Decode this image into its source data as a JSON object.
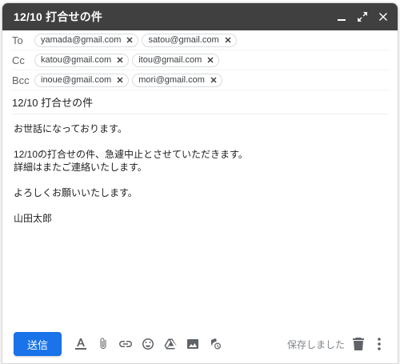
{
  "window": {
    "title": "12/10 打合せの件"
  },
  "to": {
    "label": "To",
    "chips": [
      "yamada@gmail.com",
      "satou@gmail.com"
    ]
  },
  "cc": {
    "label": "Cc",
    "chips": [
      "katou@gmail.com",
      "itou@gmail.com"
    ]
  },
  "bcc": {
    "label": "Bcc",
    "chips": [
      "inoue@gmail.com",
      "mori@gmail.com"
    ]
  },
  "subject": "12/10 打合せの件",
  "body": {
    "line1": "お世話になっております。",
    "line2": "12/10の打合せの件、急遽中止とさせていただきます。",
    "line3": "詳細はまたご連絡いたします。",
    "line4": "よろしくお願いいたします。",
    "line5": "山田太郎"
  },
  "footer": {
    "send_label": "送信",
    "saved_text": "保存しました"
  },
  "colors": {
    "header_bg": "#404040",
    "send_button": "#1a73e8"
  }
}
